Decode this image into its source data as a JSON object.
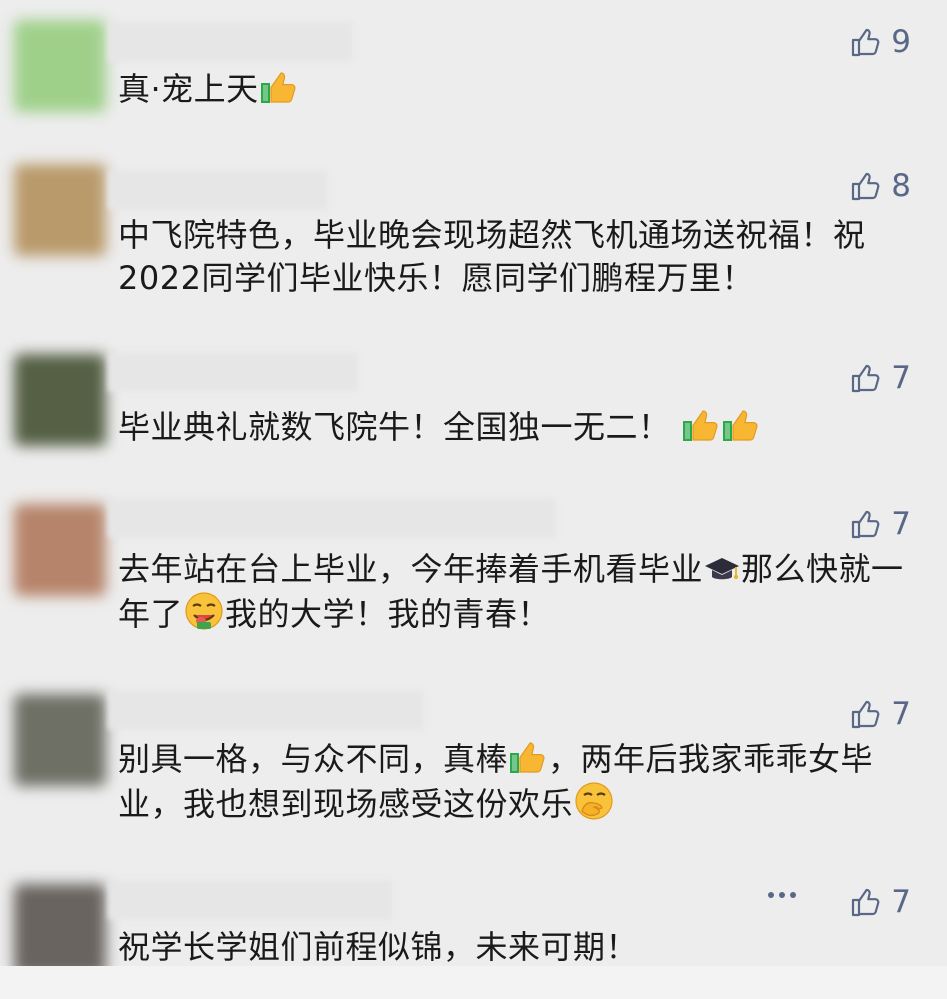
{
  "comments": [
    {
      "likes": "9",
      "segments": [
        "真·宠上天",
        "👍"
      ],
      "avatar_color": "#9fd08a"
    },
    {
      "likes": "8",
      "segments": [
        "中飞院特色，毕业晚会现场超然飞机通场送祝福！祝2022同学们毕业快乐！愿同学们鹏程万里！"
      ],
      "avatar_color": "#b99a6b"
    },
    {
      "likes": "7",
      "segments": [
        "毕业典礼就数飞院牛！全国独一无二！",
        "👍",
        "👍"
      ],
      "avatar_color": "#556045"
    },
    {
      "likes": "7",
      "segments": [
        "去年站在台上毕业，今年捧着手机看毕业",
        "🎓",
        "那么快就一年了",
        "😋",
        "我的大学！我的青春！"
      ],
      "avatar_color": "#b6846a"
    },
    {
      "likes": "7",
      "segments": [
        "别具一格，与众不同，真棒",
        "👍",
        "，两年后我家乖乖女毕业，我也想到现场感受这份欢乐",
        "🤭"
      ],
      "avatar_color": "#6e7066"
    },
    {
      "likes": "7",
      "segments": [
        "祝学长学姐们前程似锦，未来可期！"
      ],
      "avatar_color": "#6a6460"
    }
  ],
  "icons": {
    "like": "thumbs-up-outline-icon",
    "more": "more-dots-icon"
  },
  "colors": {
    "background": "#ededed",
    "like_color": "#5a6888",
    "text": "#1a1a1a"
  }
}
